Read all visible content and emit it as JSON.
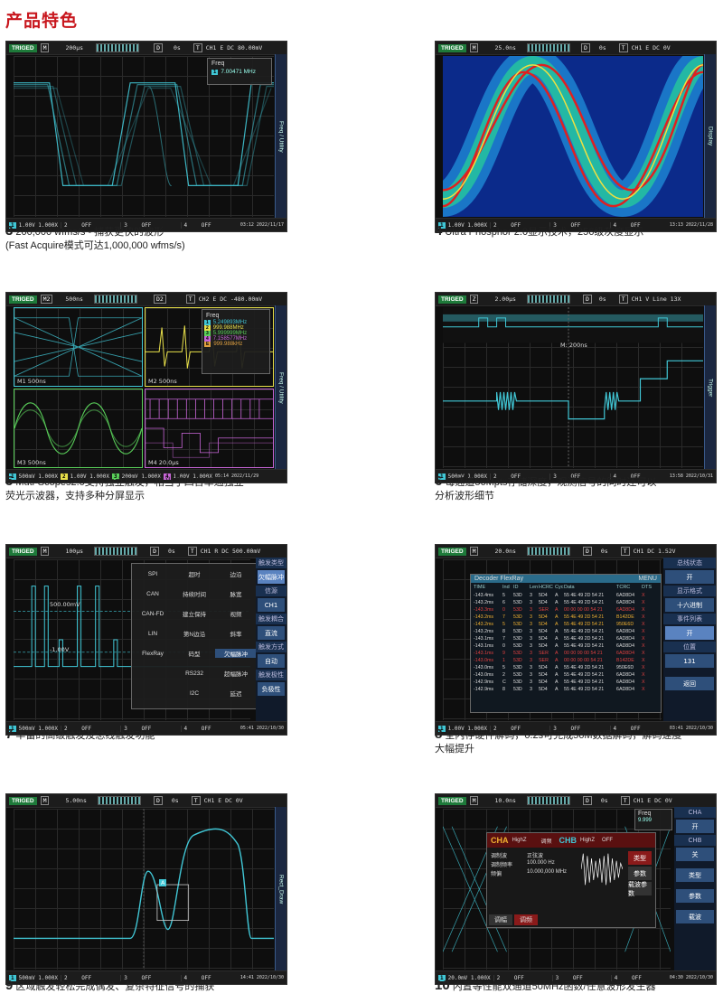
{
  "page": {
    "title": "产品特色"
  },
  "colors": {
    "ch1": "#41c7d6",
    "ch2": "#e8e04a",
    "ch3": "#5ad05a",
    "ch4": "#c866d8",
    "title": "#c8161d"
  },
  "bottom_bar": {
    "ch1": "1.00V 1.000X",
    "ch1b": "500mV 1.000X",
    "off": "OFF",
    "n1": "1",
    "n2": "2",
    "n3": "3",
    "n4": "4"
  },
  "screens": [
    {
      "num": "3",
      "trig": "TRIGED",
      "mode": "M",
      "time": "200µs",
      "delay": "0s",
      "trig_info": "CH1 E DC 80.00mV",
      "side": "Freq / Utility",
      "freq_label": "Freq",
      "freq_value": "7.00471 MHz",
      "clock": "03:12 2022/11/17",
      "caption_line1": "200,000 wfms/s - 捕获更快的波形",
      "caption_line2": "(Fast Acquire模式可达1,000,000 wfms/s)"
    },
    {
      "num": "4",
      "trig": "TRIGED",
      "mode": "M",
      "time": "25.0ns",
      "delay": "0s",
      "trig_info": "CH1 E DC 0V",
      "side": "Display",
      "clock": "13:13 2022/11/28",
      "caption_line1": "Ultra Phosphor 2.0显示技术，256级灰度显示"
    },
    {
      "num": "5",
      "trig": "TRIGED",
      "mode": "M2",
      "time": "500ns",
      "delay": "D2",
      "trig_info": "CH2 E DC -480.00mV",
      "side": "Freq / Utility",
      "freq_label": "Freq",
      "freqs": [
        "5.249893MHz",
        "999.988MHz",
        "5.999999MHz",
        "7.158577MHz",
        "999.988kHz"
      ],
      "m1": "M1 500ns",
      "m2": "M2 500ns",
      "m3": "M3 500ns",
      "m4": "M4 20.0µs",
      "ch2": "1.00V 1.000X",
      "ch3": "200mV 1.000X",
      "ch4": "1.00V 1.000X",
      "clock": "05:14 2022/11/29",
      "caption_line1": "Muti-Scopes2.0支持独立触发，相当于四台单通独立",
      "caption_line2": "荧光示波器，支持多种分屏显示"
    },
    {
      "num": "6",
      "trig": "TRIGED",
      "mode": "Z",
      "time": "2.00µs",
      "delay": "0s",
      "trig_info": "CH1 V Line 13X",
      "side": "Trigger",
      "zoom_label": "M: 200ns",
      "clock": "13:58 2022/10/31",
      "caption_line1": "每通道56Mpts存储深度，观测信号的同时还可以",
      "caption_line2": "分析波形细节"
    },
    {
      "num": "7",
      "trig": "TRIGED",
      "mode": "M",
      "time": "100µs",
      "delay": "0s",
      "trig_info": "CH1 R DC 500.00mV",
      "clock": "05:41 2022/10/30",
      "level": "500.00mV",
      "level2": "-1.00V",
      "menu": [
        "SPI",
        "超时",
        "边沿",
        "CAN",
        "持续时间",
        "脉宽",
        "CAN-FD",
        "建立保持",
        "视频",
        "LIN",
        "第N边沿",
        "斜率",
        "FlexRay",
        "码型",
        "欠幅脉冲",
        "",
        "RS232",
        "超幅脉冲",
        "",
        "I2C",
        "延迟"
      ],
      "right": [
        "触发类型",
        "欠幅脉冲",
        "信源",
        "CH1",
        "触发耦合",
        "直流",
        "触发方式",
        "自动",
        "触发极性",
        "负极性"
      ],
      "caption_line1": "丰富的高级触发及总线触发功能"
    },
    {
      "num": "8",
      "trig": "TRIGED",
      "mode": "M",
      "time": "20.0ns",
      "delay": "0s",
      "trig_info": "CH1 DC 1.52V",
      "side": "DecodeBus / Decod",
      "clock": "03:41 2022/10/30",
      "decoder_title": "Decoder FlexRay",
      "menu_label": "MENU",
      "headers": [
        "TIME",
        "Ind",
        "ID",
        "Len",
        "HCRC",
        "Cyc",
        "Data",
        "TCRC",
        "DTS"
      ],
      "rows": [
        [
          "-143.4ms",
          "5",
          "53D",
          "3",
          "5D4",
          "A",
          "55 4E 49 2D 54 21",
          "6AD8D4",
          "X"
        ],
        [
          "-143.2ms",
          "6",
          "53D",
          "3",
          "5D4",
          "A",
          "55 4E 49 2D 54 21",
          "6AD8D4",
          "X"
        ],
        [
          "-143.3ms",
          "0",
          "53D",
          "3",
          "SER",
          "A",
          "00 00 00 00 54 21",
          "6AD8D4",
          "X"
        ],
        [
          "-143.2ms",
          "7",
          "53D",
          "3",
          "5D4",
          "A",
          "55 4E 49 2D 54 21",
          "B142DE",
          "X"
        ],
        [
          "-143.2ms",
          "5",
          "53D",
          "3",
          "5D4",
          "A",
          "55 4E 49 2D 54 21",
          "950E6D",
          "X"
        ],
        [
          "-143.2ms",
          "8",
          "53D",
          "3",
          "5D4",
          "A",
          "55 4E 49 2D 54 21",
          "6AD8D4",
          "X"
        ],
        [
          "-143.1ms",
          "7",
          "53D",
          "3",
          "5D4",
          "A",
          "55 4E 49 2D 54 21",
          "6AD8D4",
          "X"
        ],
        [
          "-143.1ms",
          "0",
          "53D",
          "3",
          "5D4",
          "A",
          "55 4E 49 2D 54 21",
          "6AD8D4",
          "X"
        ],
        [
          "-143.1ms",
          "9",
          "53D",
          "3",
          "SER",
          "A",
          "00 00 00 00 54 21",
          "6AD8D4",
          "X"
        ],
        [
          "-143.0ms",
          "1",
          "53D",
          "3",
          "SER",
          "A",
          "00 00 00 00 54 21",
          "B142DE",
          "X"
        ],
        [
          "-143.0ms",
          "5",
          "53D",
          "3",
          "5D4",
          "A",
          "55 4E 49 2D 54 21",
          "950E6D",
          "X"
        ],
        [
          "-143.0ms",
          "2",
          "53D",
          "3",
          "5D4",
          "A",
          "55 4E 49 2D 54 21",
          "6AD8D4",
          "X"
        ],
        [
          "-142.9ms",
          "C",
          "53D",
          "3",
          "5D4",
          "A",
          "55 4E 49 2D 54 21",
          "6AD8D4",
          "X"
        ],
        [
          "-142.9ms",
          "8",
          "53D",
          "3",
          "5D4",
          "A",
          "55 4E 49 2D 54 21",
          "6AD8D4",
          "X"
        ]
      ],
      "right": [
        "总线状态",
        "开",
        "显示格式",
        "十六进制",
        "事件列表",
        "开",
        "位置",
        "131",
        "返回"
      ],
      "caption_line1": "全内存硬件解码，0.2s可完成56M数据解码，解码速度",
      "caption_line2": "大幅提升"
    },
    {
      "num": "9",
      "trig": "TRIGED",
      "mode": "M",
      "time": "5.00ns",
      "delay": "0s",
      "trig_info": "CH1 E DC 0V",
      "side": "Rect_Draw",
      "clock": "14:41 2022/10/30",
      "zone": "A",
      "caption_line1": "区域触发轻松完成偶发、复杂特征信号的捕获"
    },
    {
      "num": "10",
      "trig": "TRIGED",
      "mode": "M",
      "time": "10.0ns",
      "delay": "0s",
      "trig_info": "CH1 E DC 0V",
      "side": "AWG_MOD",
      "clock": "04:30 2022/10/30",
      "freq_label": "Freq",
      "freq_value": "9.999",
      "cha": "CHA",
      "chb": "CHB",
      "highz": "HighZ",
      "mod": "调频",
      "off": "OFF",
      "params": [
        [
          "调制波",
          "正弦波"
        ],
        [
          "调制频率",
          "100.000 Hz"
        ],
        [
          "频偏",
          "10.000,000 MHz"
        ]
      ],
      "tabs": [
        "调幅",
        "调频"
      ],
      "buttons": [
        "类型",
        "参数",
        "载波参数"
      ],
      "right": [
        "CHA",
        "开",
        "CHB",
        "关",
        "类型",
        "参数",
        "载波"
      ],
      "ch1": "20.0mV 1.000X",
      "caption_line1": "内置等性能双通道50MHz函数/任意波形发生器"
    }
  ]
}
